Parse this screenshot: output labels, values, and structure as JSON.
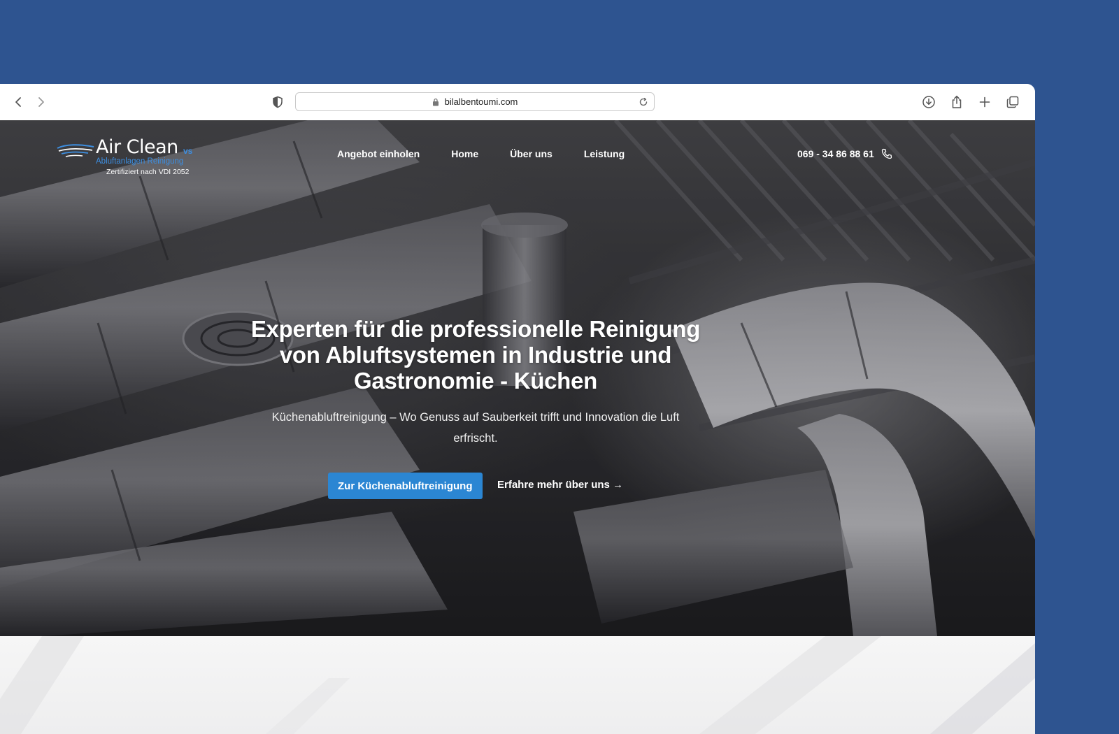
{
  "browser": {
    "url": "bilalbentoumi.com",
    "icons": {
      "back": "chevron-left-icon",
      "forward": "chevron-right-icon",
      "privacy": "shield-icon",
      "lock": "lock-icon",
      "reload": "reload-icon",
      "downloads": "download-icon",
      "share": "share-icon",
      "new_tab": "plus-icon",
      "tabs": "tabs-overview-icon"
    }
  },
  "site": {
    "logo": {
      "name": "Air Clean",
      "suffix": "vs",
      "tagline": "Abluftanlagen Reinigung",
      "certification": "Zertifiziert nach VDI 2052"
    },
    "nav": [
      {
        "label": "Angebot einholen"
      },
      {
        "label": "Home"
      },
      {
        "label": "Über uns"
      },
      {
        "label": "Leistung"
      }
    ],
    "phone": "069 - 34 86 88 61",
    "hero": {
      "headline": "Experten für die professionelle Reinigung von Abluftsystemen in Industrie und Gastronomie - Küchen",
      "subline": "Küchenabluftreinigung – Wo Genuss auf Sauberkeit trifft und Innovation die Luft erfrischt.",
      "primary_cta": "Zur Küchenabluftreinigung",
      "secondary_cta": "Erfahre mehr über uns →"
    },
    "colors": {
      "accent": "#2b86d3",
      "logo_blue": "#3d8ee0",
      "backdrop": "#2e5490"
    }
  }
}
